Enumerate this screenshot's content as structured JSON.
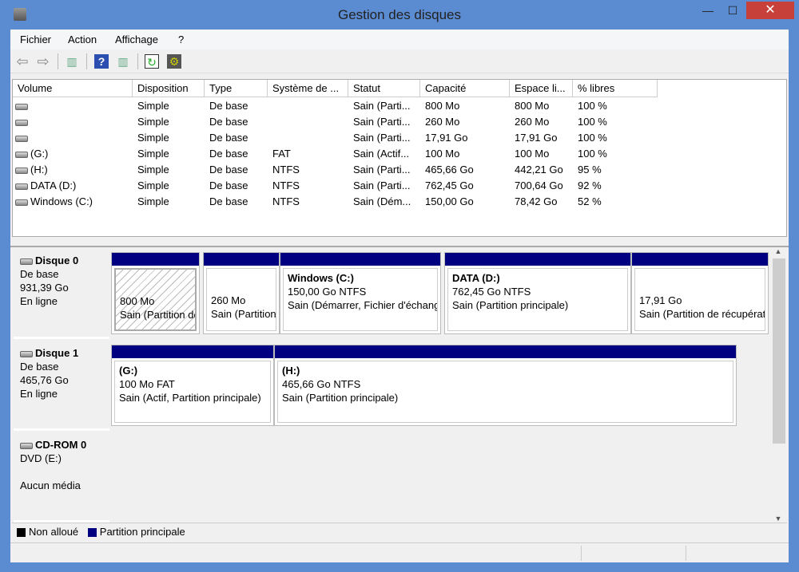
{
  "window": {
    "title": "Gestion des disques",
    "minimize": "—",
    "maximize": "☐",
    "close": "✕"
  },
  "menu": [
    "Fichier",
    "Action",
    "Affichage",
    "?"
  ],
  "toolbar": [
    {
      "icon": "back-arrow-icon",
      "glyph": "⇦"
    },
    {
      "icon": "forward-arrow-icon",
      "glyph": "⇨"
    },
    {
      "icon": "show-hide-console-tree-icon",
      "glyph": "▥"
    },
    {
      "icon": "help-icon",
      "glyph": "?"
    },
    {
      "icon": "show-hide-action-pane-icon",
      "glyph": "▥"
    },
    {
      "icon": "refresh-icon",
      "glyph": "↻"
    },
    {
      "icon": "properties-icon",
      "glyph": "⚙"
    }
  ],
  "columns": [
    "Volume",
    "Disposition",
    "Type",
    "Système de ...",
    "Statut",
    "Capacité",
    "Espace li...",
    "% libres"
  ],
  "rows": [
    [
      "",
      "Simple",
      "De base",
      "",
      "Sain (Parti...",
      "800 Mo",
      "800 Mo",
      "100 %"
    ],
    [
      "",
      "Simple",
      "De base",
      "",
      "Sain (Parti...",
      "260 Mo",
      "260 Mo",
      "100 %"
    ],
    [
      "",
      "Simple",
      "De base",
      "",
      "Sain (Parti...",
      "17,91 Go",
      "17,91 Go",
      "100 %"
    ],
    [
      "(G:)",
      "Simple",
      "De base",
      "FAT",
      "Sain (Actif...",
      "100 Mo",
      "100 Mo",
      "100 %"
    ],
    [
      "(H:)",
      "Simple",
      "De base",
      "NTFS",
      "Sain (Parti...",
      "465,66 Go",
      "442,21 Go",
      "95 %"
    ],
    [
      "DATA (D:)",
      "Simple",
      "De base",
      "NTFS",
      "Sain (Parti...",
      "762,45 Go",
      "700,64 Go",
      "92 %"
    ],
    [
      "Windows (C:)",
      "Simple",
      "De base",
      "NTFS",
      "Sain (Dém...",
      "150,00 Go",
      "78,42 Go",
      "52 %"
    ]
  ],
  "disks": [
    {
      "name": "Disque 0",
      "type": "De base",
      "size": "931,39 Go",
      "state": "En ligne",
      "partitions": [
        {
          "title": "",
          "size": "800 Mo",
          "status": "Sain (Partition de récupération)",
          "selected": true
        },
        {
          "title": "",
          "size": "260 Mo",
          "status": "Sain (Partition système EFI)"
        },
        {
          "title": "Windows  (C:)",
          "size": "150,00 Go NTFS",
          "status": "Sain (Démarrer, Fichier d'échange)"
        },
        {
          "title": "DATA  (D:)",
          "size": "762,45 Go NTFS",
          "status": "Sain (Partition principale)"
        },
        {
          "title": "",
          "size": "17,91 Go",
          "status": "Sain (Partition de récupération)"
        }
      ]
    },
    {
      "name": "Disque 1",
      "type": "De base",
      "size": "465,76 Go",
      "state": "En ligne",
      "partitions": [
        {
          "title": "(G:)",
          "size": "100 Mo FAT",
          "status": "Sain (Actif, Partition principale)"
        },
        {
          "title": "(H:)",
          "size": "465,66 Go NTFS",
          "status": "Sain (Partition principale)"
        }
      ]
    },
    {
      "name": "CD-ROM 0",
      "type": "DVD (E:)",
      "size": "",
      "state": "Aucun média",
      "partitions": []
    }
  ],
  "legend": [
    {
      "label": "Non alloué",
      "color": "#000000"
    },
    {
      "label": "Partition principale",
      "color": "#000080"
    }
  ],
  "colors": {
    "partition_bar": "#000080",
    "title_bar": "#5b8bd1",
    "close_button": "#c7413a"
  }
}
